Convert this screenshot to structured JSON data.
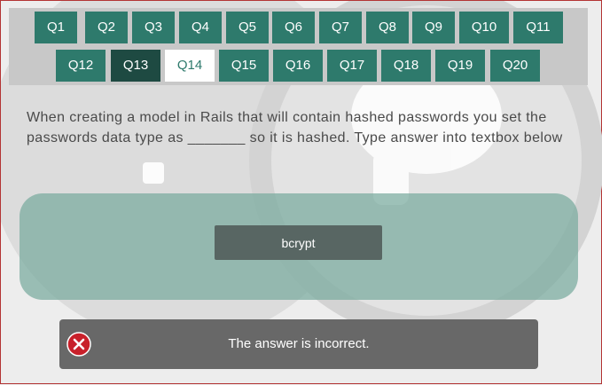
{
  "navigation": {
    "questions": [
      {
        "label": "Q1"
      },
      {
        "label": "Q2"
      },
      {
        "label": "Q3"
      },
      {
        "label": "Q4"
      },
      {
        "label": "Q5"
      },
      {
        "label": "Q6"
      },
      {
        "label": "Q7"
      },
      {
        "label": "Q8"
      },
      {
        "label": "Q9"
      },
      {
        "label": "Q10"
      },
      {
        "label": "Q11"
      },
      {
        "label": "Q12"
      },
      {
        "label": "Q13",
        "state": "visited"
      },
      {
        "label": "Q14",
        "state": "current"
      },
      {
        "label": "Q15"
      },
      {
        "label": "Q16"
      },
      {
        "label": "Q17"
      },
      {
        "label": "Q18"
      },
      {
        "label": "Q19"
      },
      {
        "label": "Q20"
      }
    ]
  },
  "question": {
    "text": "When creating a model in Rails that will contain hashed passwords you set the passwords data type as _______ so it is hashed. Type answer into textbox below"
  },
  "answer": {
    "value": "bcrypt"
  },
  "feedback": {
    "message": "The answer is incorrect.",
    "icon": "error-x-icon"
  },
  "colors": {
    "question_button": "#2e7a6c",
    "visited_button": "#1e4a42",
    "current_button": "#ffffff",
    "error": "#c8202a"
  }
}
